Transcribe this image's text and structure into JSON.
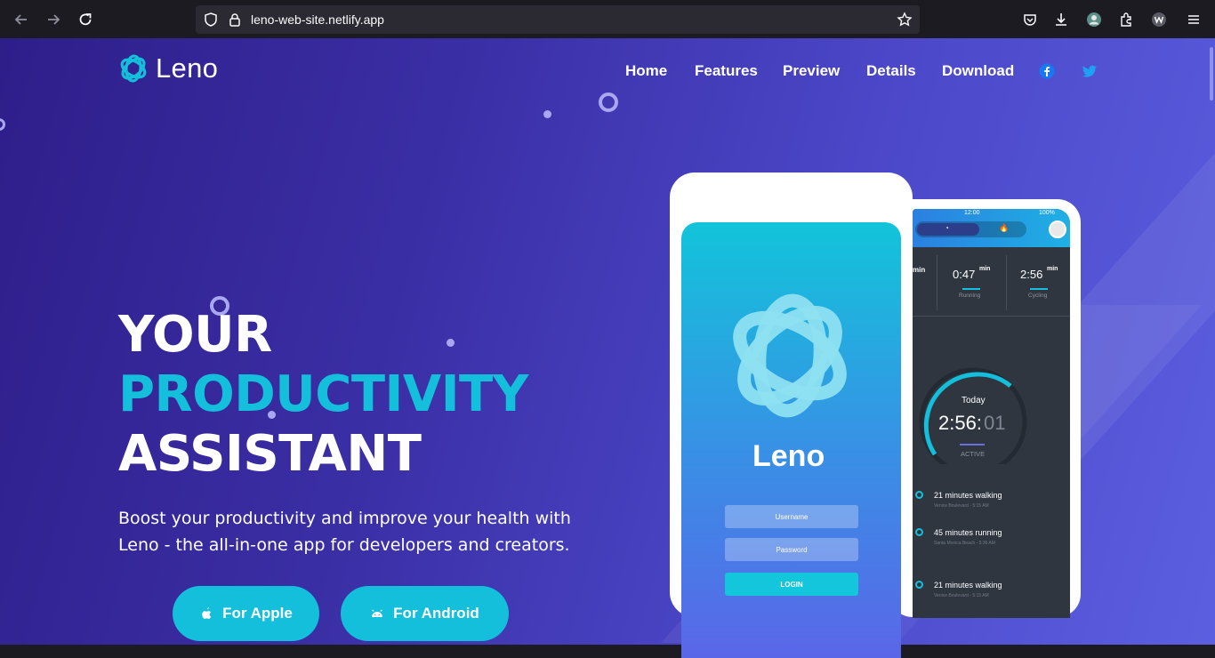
{
  "browser": {
    "url": "leno-web-site.netlify.app"
  },
  "nav": {
    "brand": "Leno",
    "items": [
      {
        "label": "Home"
      },
      {
        "label": "Features"
      },
      {
        "label": "Preview"
      },
      {
        "label": "Details"
      },
      {
        "label": "Download"
      }
    ]
  },
  "hero": {
    "line1": "YOUR",
    "line2": "PRODUCTIVITY",
    "line3": "ASSISTANT",
    "description_line1": "Boost your productivity and improve your health with",
    "description_line2": "Leno - the all-in-one app for developers and creators.",
    "apple_button": "For Apple",
    "android_button": "For Android"
  },
  "phone_front": {
    "app_name": "Leno",
    "username_placeholder": "Username",
    "password_placeholder": "Password",
    "login_label": "LOGIN"
  },
  "phone_back": {
    "status_time": "12:00",
    "battery": "100%",
    "stats": [
      {
        "value": "",
        "unit": "min",
        "label": ""
      },
      {
        "value": "0:47",
        "unit": "min",
        "label": "Running"
      },
      {
        "value": "2:56",
        "unit": "min",
        "label": "Cycling"
      }
    ],
    "today_label": "Today",
    "timer_main": "2:56:",
    "timer_dim": "01",
    "active_label": "ACTIVE",
    "activities": [
      {
        "title": "21 minutes walking",
        "subtitle": "Venice Boulevard - 5:15 AM"
      },
      {
        "title": "45 minutes running",
        "subtitle": "Santa Monica Beach - 5:36 AM"
      },
      {
        "title": "21 minutes walking",
        "subtitle": "Venice Boulevard - 5:15 AM"
      }
    ]
  },
  "colors": {
    "accent": "#14bfdc",
    "background_start": "#2e1e8a",
    "background_end": "#5b5fe0",
    "facebook": "#1877f2",
    "twitter": "#1da1f2"
  },
  "icons": [
    "back-icon",
    "forward-icon",
    "reload-icon",
    "shield-icon",
    "lock-icon",
    "star-icon",
    "pocket-icon",
    "download-icon",
    "avatar",
    "extensions-icon",
    "profile-icon",
    "menu-icon",
    "facebook-icon",
    "twitter-icon",
    "apple-icon",
    "android-icon"
  ]
}
